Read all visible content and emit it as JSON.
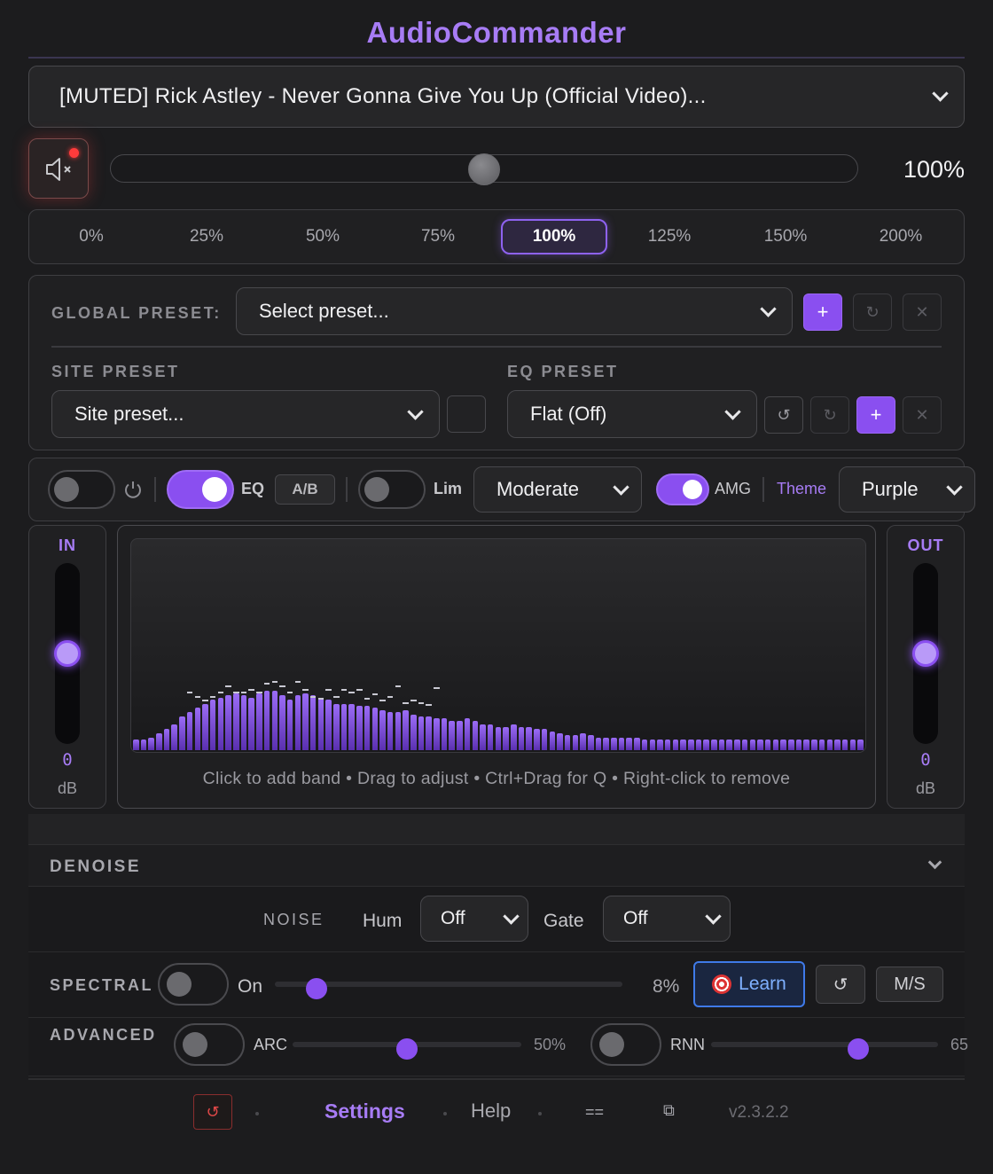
{
  "app": {
    "title": "AudioCommander",
    "version": "v2.3.2.2"
  },
  "tab_select": {
    "value": "[MUTED] Rick Astley - Never Gonna Give You Up (Official Video)..."
  },
  "volume": {
    "readout": "100%",
    "level_fraction": 0.5,
    "presets": [
      "0%",
      "25%",
      "50%",
      "75%",
      "100%",
      "125%",
      "150%",
      "200%"
    ],
    "active_preset": "100%"
  },
  "global_preset": {
    "label": "GLOBAL PRESET:",
    "value": "Select preset...",
    "add": "+",
    "refresh": "↻",
    "remove": "✕"
  },
  "site_preset": {
    "label": "SITE PRESET",
    "value": "Site preset..."
  },
  "eq_preset": {
    "label": "EQ PRESET",
    "value": "Flat (Off)",
    "undo": "↺",
    "redo": "↻",
    "add": "+",
    "remove": "✕"
  },
  "toggles": {
    "power_on": false,
    "eq": {
      "label": "EQ",
      "on": true
    },
    "ab_label": "A/B",
    "lim": {
      "label": "Lim",
      "on": false
    },
    "lim_mode": "Moderate",
    "amg": {
      "label": "AMG",
      "on": true
    },
    "theme_label": "Theme",
    "theme_value": "Purple"
  },
  "meters": {
    "in": {
      "label": "IN",
      "value": "0",
      "unit": "dB"
    },
    "out": {
      "label": "OUT",
      "value": "0",
      "unit": "dB"
    }
  },
  "eq_graph": {
    "hint": "Click to add band • Drag to adjust • Ctrl+Drag for Q • Right-click to remove",
    "accent": "#8a4ff0",
    "spectrum_levels": [
      0.05,
      0.05,
      0.06,
      0.08,
      0.1,
      0.12,
      0.16,
      0.18,
      0.2,
      0.22,
      0.24,
      0.25,
      0.26,
      0.27,
      0.26,
      0.25,
      0.27,
      0.28,
      0.28,
      0.26,
      0.24,
      0.26,
      0.27,
      0.26,
      0.25,
      0.24,
      0.22,
      0.22,
      0.22,
      0.21,
      0.21,
      0.2,
      0.19,
      0.18,
      0.18,
      0.19,
      0.17,
      0.16,
      0.16,
      0.15,
      0.15,
      0.14,
      0.14,
      0.15,
      0.14,
      0.12,
      0.12,
      0.11,
      0.11,
      0.12,
      0.11,
      0.11,
      0.1,
      0.1,
      0.09,
      0.08,
      0.07,
      0.07,
      0.08,
      0.07,
      0.06,
      0.06,
      0.06,
      0.06,
      0.06,
      0.06,
      0.05,
      0.05,
      0.05,
      0.05,
      0.05,
      0.05,
      0.05,
      0.05,
      0.05,
      0.05,
      0.05,
      0.05,
      0.05,
      0.05,
      0.05,
      0.05,
      0.05,
      0.05,
      0.05,
      0.05,
      0.05,
      0.05,
      0.05,
      0.05,
      0.05,
      0.05,
      0.05,
      0.05,
      0.05
    ],
    "peak_levels": [
      0.0,
      0.0,
      0.0,
      0.0,
      0.0,
      0.0,
      0.0,
      0.27,
      0.25,
      0.23,
      0.25,
      0.27,
      0.3,
      0.27,
      0.27,
      0.28,
      0.27,
      0.31,
      0.32,
      0.3,
      0.27,
      0.32,
      0.28,
      0.25,
      0.24,
      0.28,
      0.25,
      0.28,
      0.27,
      0.28,
      0.24,
      0.26,
      0.23,
      0.25,
      0.3,
      0.22,
      0.23,
      0.22,
      0.21,
      0.29,
      0.0,
      0.0,
      0.0,
      0.0,
      0.0,
      0.0,
      0.0,
      0.0,
      0.0,
      0.0,
      0.0,
      0.0,
      0.0,
      0.0,
      0.0,
      0.0,
      0.0,
      0.0,
      0.0,
      0.0,
      0.0,
      0.0,
      0.0,
      0.0,
      0.0,
      0.0,
      0.0,
      0.0,
      0.0,
      0.0,
      0.0,
      0.0,
      0.0,
      0.0,
      0.0,
      0.0,
      0.0,
      0.0,
      0.0,
      0.0,
      0.0,
      0.0,
      0.0,
      0.0,
      0.0,
      0.0,
      0.0,
      0.0,
      0.0,
      0.0,
      0.0,
      0.0,
      0.0,
      0.0,
      0.0
    ]
  },
  "denoise": {
    "title": "DENOISE",
    "noise": {
      "label": "NOISE",
      "hum_label": "Hum",
      "hum_value": "Off",
      "gate_label": "Gate",
      "gate_value": "Off"
    },
    "spectral": {
      "label": "SPECTRAL",
      "toggle_label": "On",
      "amount": "8%",
      "amount_fraction": 0.08,
      "learn_label": "Learn",
      "reset": "↺",
      "ms_label": "M/S"
    },
    "advanced": {
      "label": "ADVANCED",
      "arc_label": "ARC",
      "arc_value": "50%",
      "arc_fraction": 0.5,
      "rnn_label": "RNN",
      "rnn_value": "65",
      "rnn_fraction": 0.65
    }
  },
  "footer": {
    "reset": "↺",
    "settings": "Settings",
    "help": "Help",
    "compact": "==",
    "popout": "⧉"
  }
}
